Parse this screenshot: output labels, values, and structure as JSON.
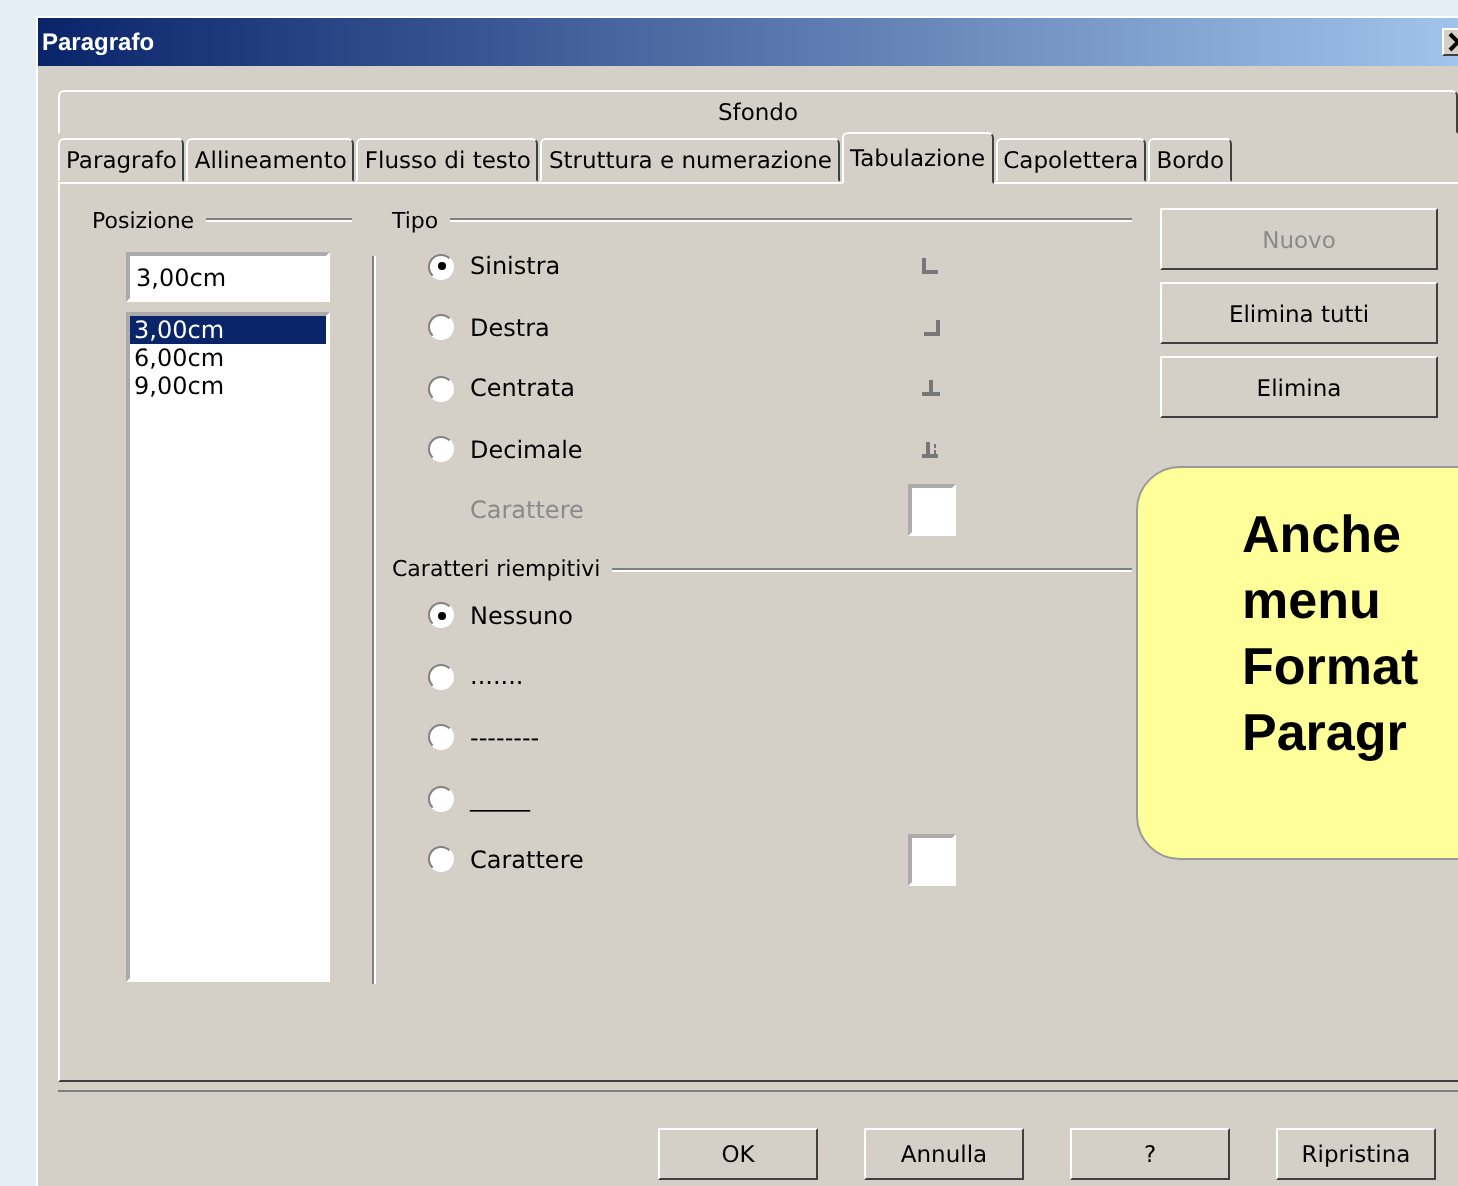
{
  "window": {
    "title": "Paragrafo"
  },
  "tab_rows": [
    [
      {
        "label": "Sfondo",
        "selected": false
      }
    ],
    [
      {
        "label": "Paragrafo",
        "selected": false
      },
      {
        "label": "Allineamento",
        "selected": false
      },
      {
        "label": "Flusso di testo",
        "selected": false
      },
      {
        "label": "Struttura e numerazione",
        "selected": false
      },
      {
        "label": "Tabulazione",
        "selected": true
      },
      {
        "label": "Capolettera",
        "selected": false
      },
      {
        "label": "Bordo",
        "selected": false
      }
    ]
  ],
  "position": {
    "label": "Posizione",
    "value": "3,00cm",
    "items": [
      {
        "text": "3,00cm",
        "selected": true
      },
      {
        "text": "6,00cm",
        "selected": false
      },
      {
        "text": "9,00cm",
        "selected": false
      }
    ]
  },
  "type": {
    "label": "Tipo",
    "options": [
      {
        "label": "Sinistra",
        "selected": true,
        "kind": "left"
      },
      {
        "label": "Destra",
        "selected": false,
        "kind": "right"
      },
      {
        "label": "Centrata",
        "selected": false,
        "kind": "center"
      },
      {
        "label": "Decimale",
        "selected": false,
        "kind": "decimal"
      }
    ],
    "character": {
      "label": "Carattere",
      "disabled": true
    }
  },
  "fill": {
    "label": "Caratteri riempitivi",
    "options": [
      {
        "label": "Nessuno",
        "selected": true,
        "kind": "text"
      },
      {
        "label": ".......",
        "selected": false,
        "kind": "text"
      },
      {
        "label": "--------",
        "selected": false,
        "kind": "text"
      },
      {
        "label": "_____",
        "selected": false,
        "kind": "text"
      },
      {
        "label": "Carattere",
        "selected": false,
        "kind": "character"
      }
    ]
  },
  "side_buttons": [
    {
      "label": "Nuovo",
      "disabled": true
    },
    {
      "label": "Elimina tutti",
      "disabled": false
    },
    {
      "label": "Elimina",
      "disabled": false
    }
  ],
  "footer_buttons": [
    "OK",
    "Annulla",
    "?",
    "Ripristina"
  ],
  "callout": {
    "lines": [
      "Anche",
      "menu",
      "Format",
      "Paragr"
    ]
  }
}
